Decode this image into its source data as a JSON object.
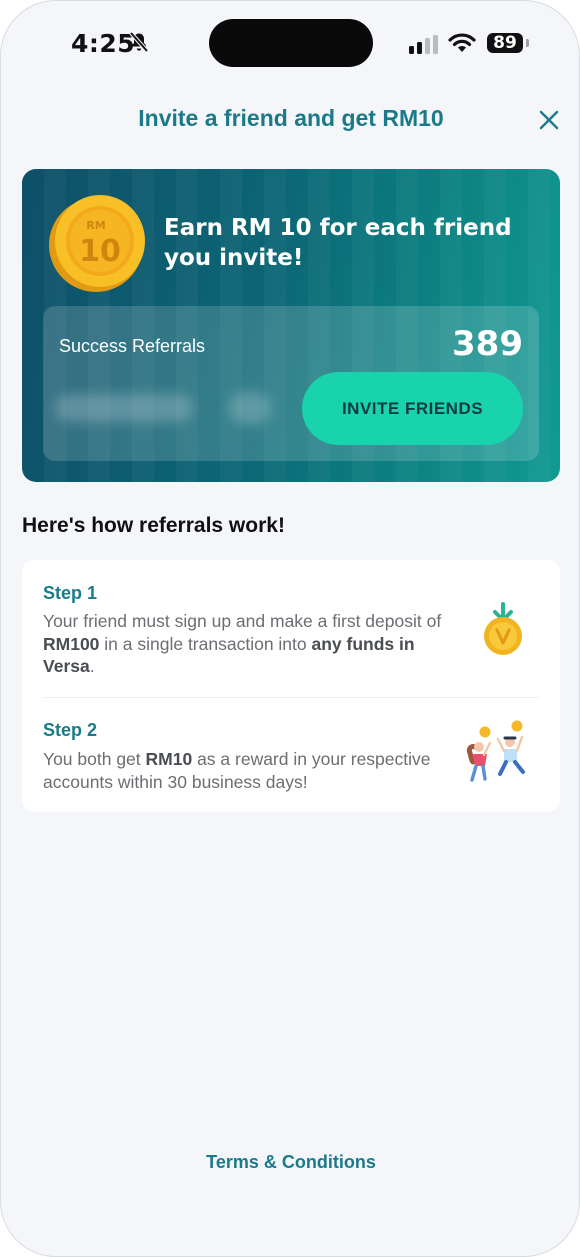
{
  "status_bar": {
    "time": "4:25",
    "battery": "89"
  },
  "header": {
    "title": "Invite a friend and get RM10"
  },
  "hero": {
    "title_line1": "Earn RM 10 for each friend",
    "title_line2": "you invite!",
    "coin_top": "RM",
    "coin_value": "10",
    "referral_label": "Success Referrals",
    "referral_count": "389",
    "invite_button": "INVITE FRIENDS"
  },
  "how_it_works": {
    "heading": "Here's how referrals work!",
    "steps": [
      {
        "title": "Step 1",
        "part1": "Your friend must sign up and make a first deposit of ",
        "bold1": "RM100",
        "part2": " in a single transaction into ",
        "bold2": "any funds in Versa",
        "part3": "."
      },
      {
        "title": "Step 2",
        "part1": "You both get ",
        "bold1": "RM10",
        "part2": " as a reward in your respective accounts within 30 business days!"
      }
    ]
  },
  "footer": {
    "terms_link": "Terms & Conditions"
  },
  "colors": {
    "accent": "#1b7a8a",
    "button": "#19d3ad",
    "card_start": "#0e4f68",
    "card_end": "#129a93"
  }
}
